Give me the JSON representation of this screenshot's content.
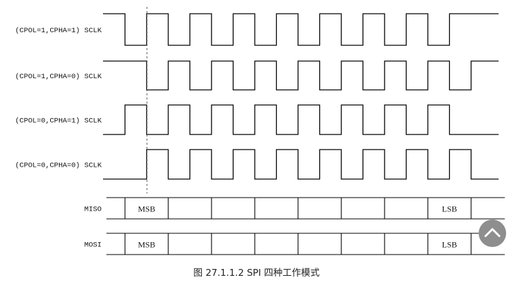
{
  "signals": [
    {
      "label": "(CPOL=1,CPHA=1) SCLK",
      "idle": "high",
      "first_edge": "falling"
    },
    {
      "label": "(CPOL=1,CPHA=0) SCLK",
      "idle": "high",
      "first_edge": "falling"
    },
    {
      "label": "(CPOL=0,CPHA=1) SCLK",
      "idle": "low",
      "first_edge": "rising"
    },
    {
      "label": "(CPOL=0,CPHA=0) SCLK",
      "idle": "low",
      "first_edge": "rising"
    }
  ],
  "data_lines": [
    {
      "label": "MISO",
      "first_bit": "MSB",
      "last_bit": "LSB",
      "bits": 8
    },
    {
      "label": "MOSI",
      "first_bit": "MSB",
      "last_bit": "LSB",
      "bits": 8
    }
  ],
  "caption": "图 27.1.1.2 SPI 四种工作模式",
  "scroll_top_icon": "chevron-up-icon"
}
